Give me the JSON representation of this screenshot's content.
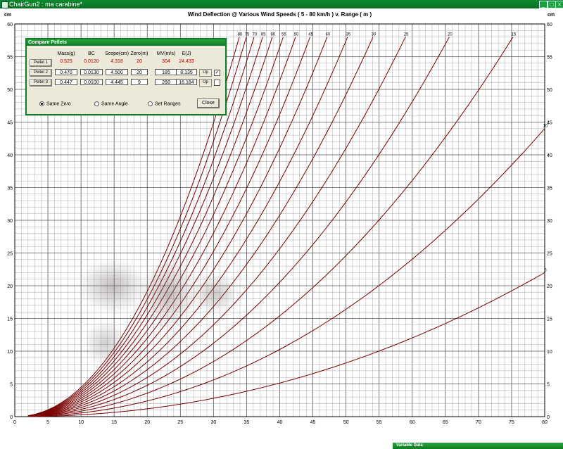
{
  "window": {
    "title": "ChairGun2 : ma carabine*"
  },
  "chart_data": {
    "type": "line",
    "title": "Wind Deflection @ Various Wind Speeds ( 5 - 80 km/h ) v. Range ( m )",
    "ylabel_left": "cm",
    "ylabel_right": "cm",
    "xlim": [
      0,
      80
    ],
    "ylim": [
      0,
      60
    ],
    "x_ticks": [
      0,
      5,
      10,
      15,
      20,
      25,
      30,
      35,
      40,
      45,
      50,
      55,
      60,
      65,
      70,
      75,
      80
    ],
    "y_ticks": [
      0,
      5,
      10,
      15,
      20,
      25,
      30,
      35,
      40,
      45,
      50,
      55,
      60
    ],
    "grid": true,
    "series_color": "#7a0000",
    "curve_model": "deflection = wind_kmh * 0.0004437 * range_m^2.1",
    "series": [
      {
        "name": "80",
        "wind_kmh": 80
      },
      {
        "name": "75",
        "wind_kmh": 75
      },
      {
        "name": "70",
        "wind_kmh": 70
      },
      {
        "name": "65",
        "wind_kmh": 65
      },
      {
        "name": "60",
        "wind_kmh": 60
      },
      {
        "name": "55",
        "wind_kmh": 55
      },
      {
        "name": "50",
        "wind_kmh": 50
      },
      {
        "name": "45",
        "wind_kmh": 45
      },
      {
        "name": "40",
        "wind_kmh": 40
      },
      {
        "name": "35",
        "wind_kmh": 35
      },
      {
        "name": "30",
        "wind_kmh": 30
      },
      {
        "name": "25",
        "wind_kmh": 25
      },
      {
        "name": "20",
        "wind_kmh": 20
      },
      {
        "name": "15",
        "wind_kmh": 15
      },
      {
        "name": "10",
        "wind_kmh": 10
      },
      {
        "name": "5",
        "wind_kmh": 5
      }
    ]
  },
  "compare_panel": {
    "title": "Compare Pellets",
    "headers": [
      "Mass(g)",
      "BC",
      "Scope(cm)",
      "Zero(m)",
      "MV(m/s)",
      "E(J)"
    ],
    "pellets": [
      {
        "label": "Pellet 1",
        "mass": "0.525",
        "bc": "0.0120",
        "scope": "4.318",
        "zero": "20",
        "mv": "304",
        "energy": "24.433"
      },
      {
        "label": "Pellet 2",
        "mass": "0.470",
        "bc": "0.0130",
        "scope": "4.500",
        "zero": "20",
        "mv": "185",
        "energy": "8.135",
        "up": "Up",
        "checked": "✓"
      },
      {
        "label": "Pellet 3",
        "mass": "0.447",
        "bc": "0.0100",
        "scope": "4.445",
        "zero": "9",
        "mv": "268",
        "energy": "16.184",
        "up": "Up",
        "checked": ""
      }
    ],
    "radios": [
      "Same Zero",
      "Same Angle",
      "Set Ranges"
    ],
    "close_label": "Close"
  },
  "bottom_panel": {
    "title": "Variable Data"
  },
  "colors": {
    "titlebar": "#0a7a27",
    "curve": "#7a0000",
    "panel_border": "#0e7e22",
    "highlight": "#c00000"
  }
}
